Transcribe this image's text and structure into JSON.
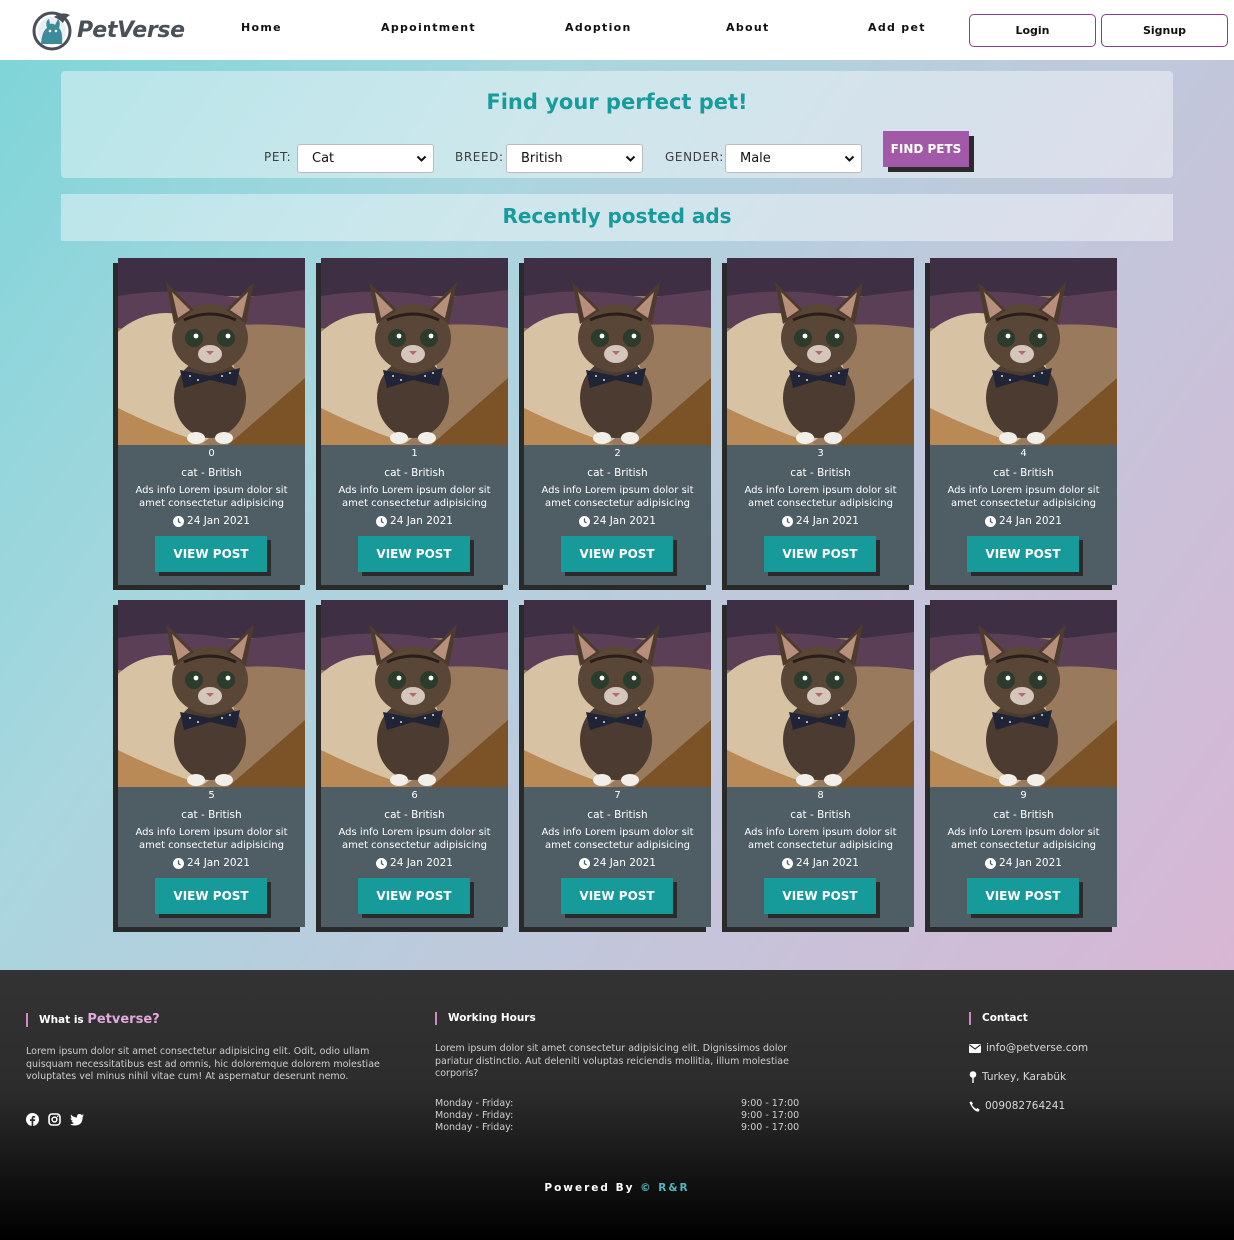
{
  "brand": {
    "name": "PetVerse",
    "accent": "#179b9b",
    "secondary": "#a25aa8"
  },
  "nav": {
    "links": [
      "Home",
      "Appointment",
      "Adoption",
      "About",
      "Add pet"
    ],
    "login": "Login",
    "signup": "Signup"
  },
  "search": {
    "title": "Find your perfect pet!",
    "pet_label": "PET:",
    "pet_value": "Cat",
    "breed_label": "BREED:",
    "breed_value": "British",
    "gender_label": "GENDER:",
    "gender_value": "Male",
    "button": "FIND PETS"
  },
  "recent": {
    "title": "Recently posted ads",
    "cards": [
      {
        "id": "0",
        "type": "cat - British",
        "desc": "Ads info Lorem ipsum dolor sit amet consectetur adipisicing",
        "date": "24 Jan 2021",
        "button": "VIEW POST"
      },
      {
        "id": "1",
        "type": "cat - British",
        "desc": "Ads info Lorem ipsum dolor sit amet consectetur adipisicing",
        "date": "24 Jan 2021",
        "button": "VIEW POST"
      },
      {
        "id": "2",
        "type": "cat - British",
        "desc": "Ads info Lorem ipsum dolor sit amet consectetur adipisicing",
        "date": "24 Jan 2021",
        "button": "VIEW POST"
      },
      {
        "id": "3",
        "type": "cat - British",
        "desc": "Ads info Lorem ipsum dolor sit amet consectetur adipisicing",
        "date": "24 Jan 2021",
        "button": "VIEW POST"
      },
      {
        "id": "4",
        "type": "cat - British",
        "desc": "Ads info Lorem ipsum dolor sit amet consectetur adipisicing",
        "date": "24 Jan 2021",
        "button": "VIEW POST"
      },
      {
        "id": "5",
        "type": "cat - British",
        "desc": "Ads info Lorem ipsum dolor sit amet consectetur adipisicing",
        "date": "24 Jan 2021",
        "button": "VIEW POST"
      },
      {
        "id": "6",
        "type": "cat - British",
        "desc": "Ads info Lorem ipsum dolor sit amet consectetur adipisicing",
        "date": "24 Jan 2021",
        "button": "VIEW POST"
      },
      {
        "id": "7",
        "type": "cat - British",
        "desc": "Ads info Lorem ipsum dolor sit amet consectetur adipisicing",
        "date": "24 Jan 2021",
        "button": "VIEW POST"
      },
      {
        "id": "8",
        "type": "cat - British",
        "desc": "Ads info Lorem ipsum dolor sit amet consectetur adipisicing",
        "date": "24 Jan 2021",
        "button": "VIEW POST"
      },
      {
        "id": "9",
        "type": "cat - British",
        "desc": "Ads info Lorem ipsum dolor sit amet consectetur adipisicing",
        "date": "24 Jan 2021",
        "button": "VIEW POST"
      }
    ]
  },
  "footer": {
    "about_prefix": "What is",
    "about_brand": "Petverse?",
    "about_text": "Lorem ipsum dolor sit amet consectetur adipisicing elit. Odit, odio ullam quisquam necessitatibus est ad omnis, hic doloremque dolorem molestiae voluptates vel minus nihil vitae cum! At aspernatur deserunt nemo.",
    "social_icons": [
      "facebook-icon",
      "instagram-icon",
      "twitter-icon"
    ],
    "hours_title": "Working Hours",
    "hours_text": "Lorem ipsum dolor sit amet consectetur adipisicing elit. Dignissimos dolor pariatur distinctio. Aut deleniti voluptas reiciendis mollitia, illum molestiae corporis?",
    "hours": [
      {
        "day": "Monday - Friday:",
        "time": "9:00 - 17:00"
      },
      {
        "day": "Monday - Friday:",
        "time": "9:00 - 17:00"
      },
      {
        "day": "Monday - Friday:",
        "time": "9:00 - 17:00"
      }
    ],
    "contact_title": "Contact",
    "email": "info@petverse.com",
    "location": "Turkey, Karabük",
    "phone": "009082764241",
    "powered_prefix": "Powered By",
    "powered_brand": "© R&R"
  }
}
